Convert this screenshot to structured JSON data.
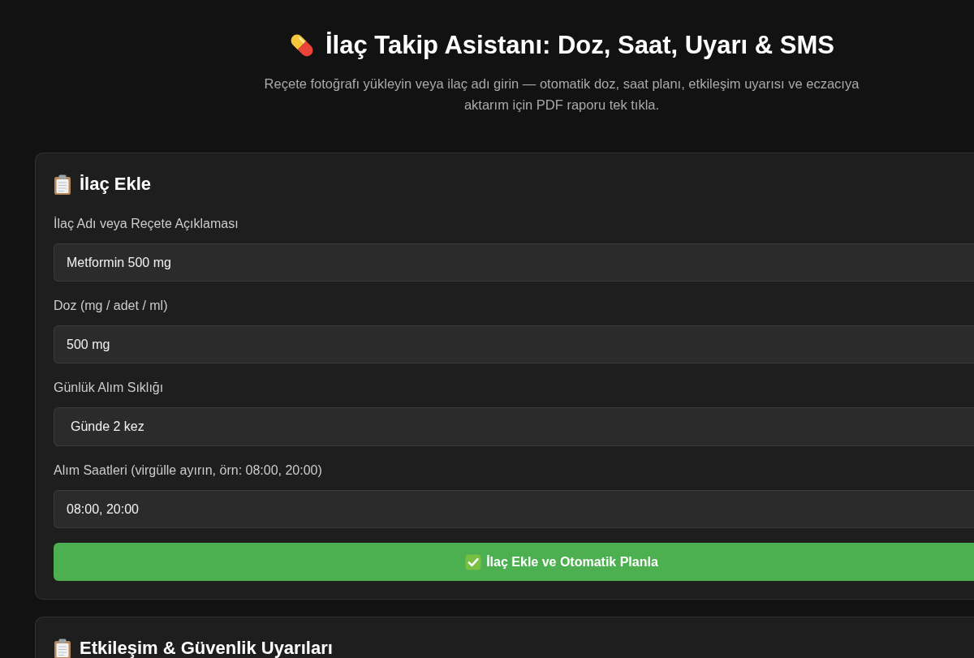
{
  "header": {
    "title": "İlaç Takip Asistanı: Doz, Saat, Uyarı & SMS",
    "subtitle": "Reçete fotoğrafı yükleyin veya ilaç adı girin — otomatik doz, saat planı, etkileşim uyarısı ve eczacıya aktarım için PDF raporu tek tıkla."
  },
  "add_medication_card": {
    "title": "İlaç Ekle",
    "fields": [
      {
        "kind": "text",
        "label": "İlaç Adı veya Reçete Açıklaması",
        "value": "Metformin 500 mg"
      },
      {
        "kind": "text",
        "label": "Doz (mg / adet / ml)",
        "value": "500 mg"
      },
      {
        "kind": "select",
        "label": "Günlük Alım Sıklığı",
        "value": "Günde 2 kez"
      },
      {
        "kind": "text",
        "label": "Alım Saatleri (virgülle ayırın, örn: 08:00, 20:00)",
        "value": "08:00, 20:00"
      }
    ],
    "submit_button": "İlaç Ekle ve Otomatik Planla"
  },
  "warnings_card": {
    "title": "Etkileşim & Güvenlik Uyarıları"
  }
}
